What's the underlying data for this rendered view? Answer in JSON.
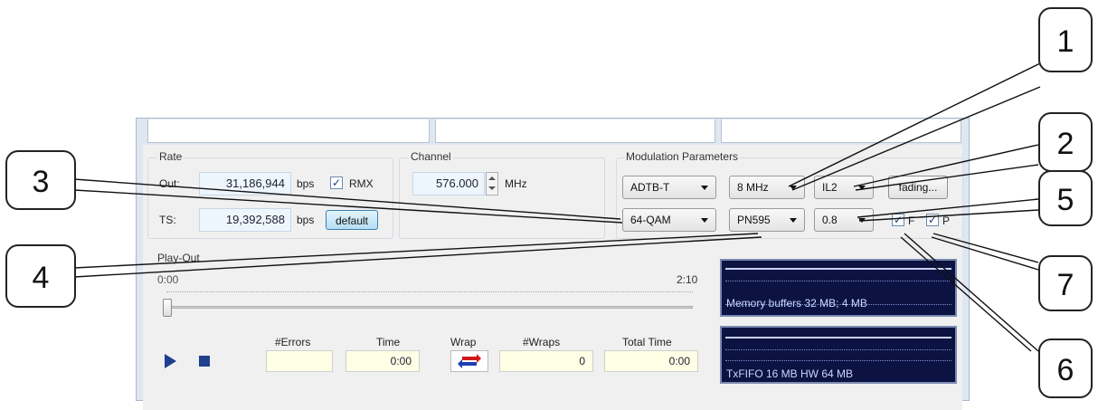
{
  "rate": {
    "title": "Rate",
    "out_label": "Out:",
    "out_value": "31,186,944",
    "out_unit": "bps",
    "rmx_label": "RMX",
    "rmx_checked": true,
    "ts_label": "TS:",
    "ts_value": "19,392,588",
    "ts_unit": "bps",
    "default_button": "default"
  },
  "channel": {
    "title": "Channel",
    "value": "576.000",
    "unit": "MHz"
  },
  "modulation": {
    "title": "Modulation Parameters",
    "standard": "ADTB-T",
    "bandwidth": "8 MHz",
    "interleave": "IL2",
    "fading_button": "fading...",
    "constellation": "64-QAM",
    "pn": "PN595",
    "code_rate": "0.8",
    "f_label": "F",
    "f_checked": true,
    "p_label": "P",
    "p_checked": true
  },
  "playout": {
    "title": "Play-Out",
    "start_time": "0:00",
    "end_time": "2:10",
    "slider_fraction": 0.0,
    "errors_label": "#Errors",
    "errors_value": "",
    "time_label": "Time",
    "time_value": "0:00",
    "wrap_label": "Wrap",
    "wraps_label": "#Wraps",
    "wraps_value": "0",
    "total_time_label": "Total Time",
    "total_time_value": "0:00"
  },
  "monitors": {
    "memory_text": "Memory buffers 32 MB; 4 MB",
    "fifo_text": "TxFIFO 16 MB   HW 64 MB"
  },
  "callouts": [
    "1",
    "2",
    "3",
    "4",
    "5",
    "6",
    "7"
  ],
  "colors": {
    "panel_bg": "#f0f0f0",
    "scope_bg": "#0c1342",
    "play_icon": "#1f3f8f"
  }
}
